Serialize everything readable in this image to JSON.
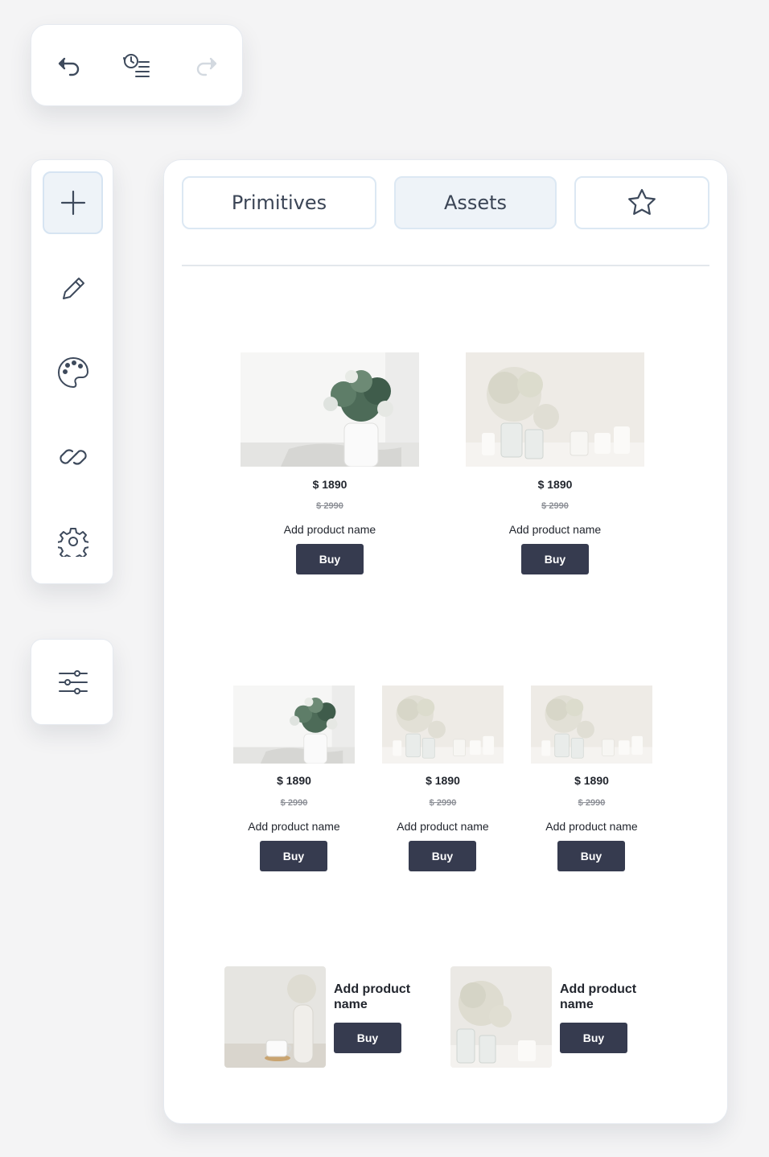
{
  "tabs": {
    "primitives": "Primitives",
    "assets": "Assets",
    "favorites_icon": "star-icon"
  },
  "toolbar": {
    "undo_icon": "undo-icon",
    "history_icon": "history-icon",
    "redo_icon": "redo-icon"
  },
  "sidebar": {
    "items": [
      "plus-icon",
      "pencil-icon",
      "palette-icon",
      "link-icon",
      "gear-icon"
    ],
    "settings_icon": "sliders-icon"
  },
  "products": {
    "row1": [
      {
        "price": "$ 1890",
        "old_price": "$ 2990",
        "name": "Add product name",
        "buy": "Buy"
      },
      {
        "price": "$ 1890",
        "old_price": "$ 2990",
        "name": "Add product name",
        "buy": "Buy"
      }
    ],
    "row2": [
      {
        "price": "$ 1890",
        "old_price": "$ 2990",
        "name": "Add product name",
        "buy": "Buy"
      },
      {
        "price": "$ 1890",
        "old_price": "$ 2990",
        "name": "Add product name",
        "buy": "Buy"
      },
      {
        "price": "$ 1890",
        "old_price": "$ 2990",
        "name": "Add product name",
        "buy": "Buy"
      }
    ],
    "row3": [
      {
        "name": "Add product name",
        "buy": "Buy"
      },
      {
        "name": "Add product name",
        "buy": "Buy"
      }
    ]
  },
  "colors": {
    "accent": "#363b4f",
    "active_tab": "#eef3f8",
    "border": "#dce8f3"
  }
}
